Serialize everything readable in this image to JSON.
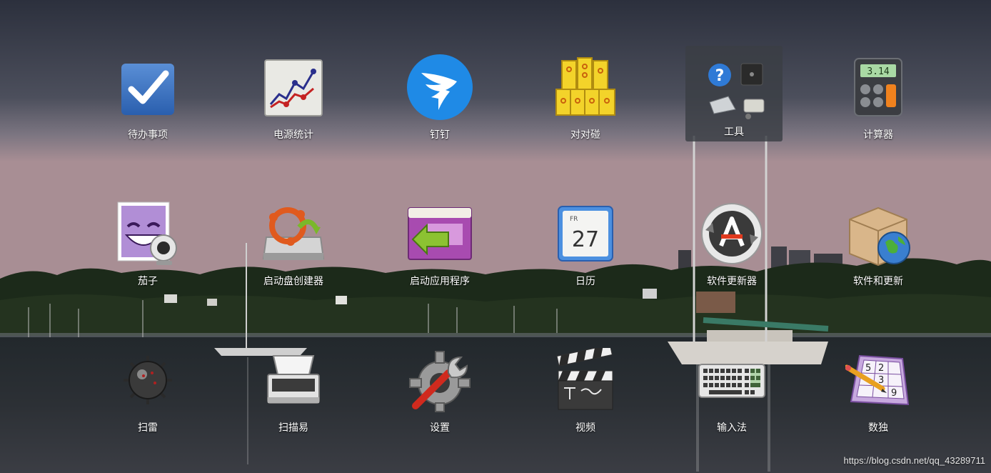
{
  "apps": [
    {
      "id": "todo",
      "label": "待办事项",
      "icon": "checkmark-icon"
    },
    {
      "id": "power",
      "label": "电源统计",
      "icon": "line-chart-icon"
    },
    {
      "id": "dingtalk",
      "label": "钉钉",
      "icon": "dingtalk-bird-icon"
    },
    {
      "id": "duiduipeng",
      "label": "对对碰",
      "icon": "gold-blocks-icon"
    },
    {
      "id": "tools",
      "label": "工具",
      "icon": "tools-folder-icon"
    },
    {
      "id": "calculator",
      "label": "计算器",
      "icon": "calculator-icon",
      "display": "3.14"
    },
    {
      "id": "cheese",
      "label": "茄子",
      "icon": "webcam-face-icon"
    },
    {
      "id": "startup-disk",
      "label": "启动盘创建器",
      "icon": "startup-disk-icon"
    },
    {
      "id": "startup-apps",
      "label": "启动应用程序",
      "icon": "startup-apps-icon"
    },
    {
      "id": "calendar",
      "label": "日历",
      "icon": "calendar-icon",
      "day_abbr": "FR",
      "day_num": "27"
    },
    {
      "id": "software-updater",
      "label": "软件更新器",
      "icon": "software-updater-icon"
    },
    {
      "id": "software-updates",
      "label": "软件和更新",
      "icon": "package-globe-icon"
    },
    {
      "id": "mines",
      "label": "扫雷",
      "icon": "mine-icon"
    },
    {
      "id": "scanner",
      "label": "扫描易",
      "icon": "scanner-icon"
    },
    {
      "id": "settings",
      "label": "设置",
      "icon": "gear-wrench-icon"
    },
    {
      "id": "video",
      "label": "视频",
      "icon": "clapperboard-icon"
    },
    {
      "id": "input-method",
      "label": "输入法",
      "icon": "keyboard-icon"
    },
    {
      "id": "sudoku",
      "label": "数独",
      "icon": "sudoku-icon",
      "digits": [
        "5",
        "2",
        "3",
        "9"
      ]
    }
  ],
  "watermark": "https://blog.csdn.net/qq_43289711"
}
